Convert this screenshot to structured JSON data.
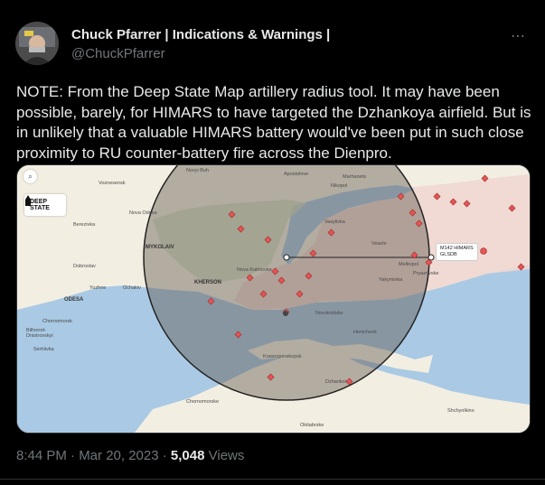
{
  "author": {
    "name": "Chuck Pfarrer | Indications & Warnings |",
    "handle": "@ChuckPfarrer"
  },
  "more_icon": "⋯",
  "tweet_text": "NOTE: From the Deep State Map artillery radius tool.  It may have been possible, barely, for HIMARS to have targeted the Dzhankoya airfield. But is in unlikely that a valuable HIMARS battery would've been put in such close proximity to RU counter-battery fire across the Dienpro.",
  "map": {
    "logo_line1": "DEEP",
    "logo_line2": "STATE",
    "search_icon": "search-icon",
    "himars_label_line1": "M142 HIMARS",
    "himars_label_line2": "GLSDB",
    "places": {
      "novyi_buh": "Novyi Buh",
      "voznesensk": "Voznesensk",
      "apostolove": "Apostolove",
      "marhanets": "Marhanets",
      "nikopol": "Nikopol",
      "nova_odesa": "Nova Odesa",
      "berezivka": "Berezivka",
      "mykolaiv": "MYKOLAIV",
      "vasylivka": "Vasylivka",
      "vesele": "Vesele",
      "melitopol": "Melitopol",
      "dobroslav": "Dobroslav",
      "yuzhne": "Yuzhne",
      "ochakiv": "Ochakiv",
      "novakakhovka": "Nova Kakhovka",
      "kherson": "KHERSON",
      "pryazovske": "Pryazovske",
      "yakymivka": "Yakymivka",
      "odesa": "ODESA",
      "novotroitske": "Novotroitske",
      "chornomorsk": "Chornomorsk",
      "bilhorod": "Bilhorod-\nDnistrovskyi",
      "serhiivka": "Serhiivka",
      "henichesk": "Henichesk",
      "krasnoperekopsk": "Krasnoperekopsk",
      "dzhankoi": "Dzhankoi",
      "chornomorske": "Chornomorske",
      "shchyolkino": "Shchyolkino",
      "oktiabrske": "Oktiabrske"
    }
  },
  "footer": {
    "time": "8:44 PM · Mar 20, 2023 · ",
    "views_count": "5,048",
    "views_label": " Views"
  }
}
